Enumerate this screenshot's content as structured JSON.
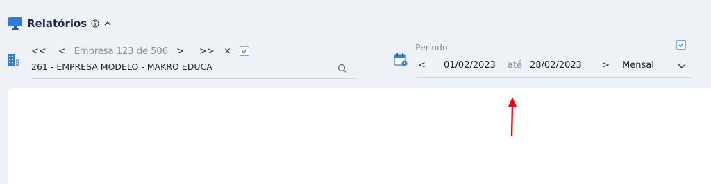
{
  "header": {
    "title": "Relatórios"
  },
  "company_nav": {
    "first_label": "<<",
    "prev_label": "<",
    "counter": "Empresa 123 de 506",
    "next_label": ">",
    "last_label": ">>",
    "clear_label": "✕",
    "selected_company": "261 - EMPRESA MODELO - MAKRO EDUCA"
  },
  "period": {
    "label": "Período",
    "prev_label": "<",
    "start_date": "01/02/2023",
    "separator": "até",
    "end_date": "28/02/2023",
    "next_label": ">",
    "mode": "Mensal"
  },
  "colors": {
    "accent": "#2a7de1",
    "title": "#1d2b47",
    "annotation_arrow": "#e01010"
  }
}
